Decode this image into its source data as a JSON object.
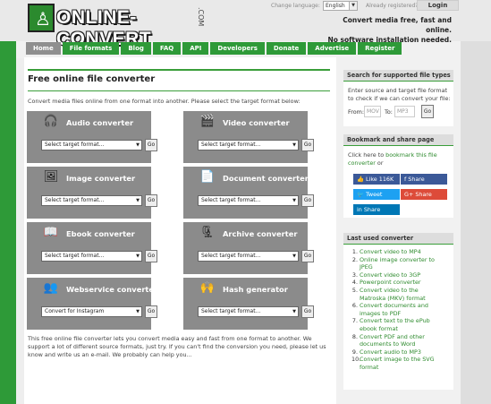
{
  "header": {
    "logo_text": "ONLINE-CONVERT",
    "logo_suffix": ".COM",
    "language_label": "Change language:",
    "language_value": "English",
    "registered_label": "Already registered?",
    "login_label": "Login",
    "tagline_line1": "Convert media free, fast and online.",
    "tagline_line2": "No software installation needed."
  },
  "nav": [
    "Home",
    "File formats",
    "Blog",
    "FAQ",
    "API",
    "Developers",
    "Donate",
    "Advertise",
    "Register"
  ],
  "main": {
    "title": "Free online file converter",
    "intro": "Convert media files online from one format into another. Please select the target format below:",
    "converters": [
      {
        "title": "Audio converter",
        "select": "Select target format...",
        "go": "Go",
        "icon": "headphones-icon"
      },
      {
        "title": "Video converter",
        "select": "Select target format...",
        "go": "Go",
        "icon": "film-icon"
      },
      {
        "title": "Image converter",
        "select": "Select target format...",
        "go": "Go",
        "icon": "image-icon"
      },
      {
        "title": "Document converter",
        "select": "Select target format...",
        "go": "Go",
        "icon": "document-icon"
      },
      {
        "title": "Ebook converter",
        "select": "Select target format...",
        "go": "Go",
        "icon": "ebook-icon"
      },
      {
        "title": "Archive converter",
        "select": "Select target format...",
        "go": "Go",
        "icon": "archive-icon"
      },
      {
        "title": "Webservice converter",
        "select": "Convert for Instagram",
        "go": "Go",
        "icon": "webservice-icon"
      },
      {
        "title": "Hash generator",
        "select": "Select target format...",
        "go": "Go",
        "icon": "hash-icon"
      }
    ],
    "outro": "This free online file converter lets you convert media easy and fast from one format to another. We support a lot of different source formats, just try. If you can't find the conversion you need, please let us know and write us an e-mail. We probably can help you..."
  },
  "sidebar": {
    "search": {
      "heading": "Search for supported file types",
      "text": "Enter source and target file format to check if we can convert your file:",
      "from_label": "From:",
      "from_placeholder": "MOV",
      "to_label": "To:",
      "to_placeholder": "MP3",
      "go": "Go"
    },
    "bookmark": {
      "heading": "Bookmark and share page",
      "text_before": "Click here to ",
      "link": "bookmark this file converter",
      "text_after": " or",
      "like": "Like 116K",
      "facebook": "Share",
      "twitter": "Tweet",
      "google": "Share",
      "linkedin": "Share"
    },
    "last_used": {
      "heading": "Last used converter",
      "items": [
        "Convert video to MP4",
        "Online image converter to JPEG",
        "Convert video to 3GP",
        "Powerpoint converter",
        "Convert video to the Matroska (MKV) format",
        "Convert documents and images to PDF",
        "Convert text to the ePub ebook format",
        "Convert PDF and other documents to Word",
        "Convert audio to MP3",
        "Convert image to the SVG format"
      ]
    }
  },
  "colors": {
    "brand_green": "#2e9a38",
    "panel_gray": "#8b8b8b",
    "link_green": "#2e8b2e"
  }
}
